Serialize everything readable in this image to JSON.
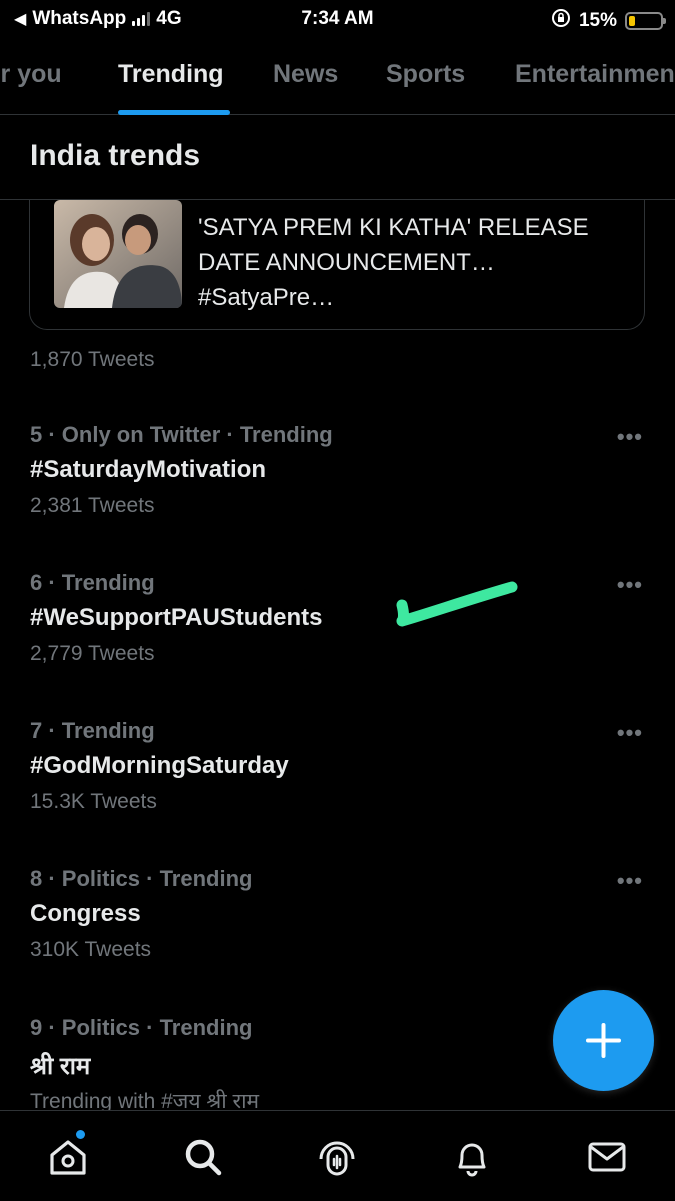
{
  "status_bar": {
    "back_app": "WhatsApp",
    "network": "4G",
    "time": "7:34 AM",
    "battery_percent": "15%",
    "battery_color": "#f5c400"
  },
  "tabs": [
    {
      "label": "For you",
      "active": false
    },
    {
      "label": "Trending",
      "active": true
    },
    {
      "label": "News",
      "active": false
    },
    {
      "label": "Sports",
      "active": false
    },
    {
      "label": "Entertainment",
      "active": false
    }
  ],
  "section": {
    "title": "India trends"
  },
  "news_card": {
    "headline": "'SATYA PREM KI KATHA' RELEASE DATE ANNOUNCEMENT… #SatyaPre…",
    "tweet_count": "1,870 Tweets"
  },
  "trends": [
    {
      "context": "5 · Only on Twitter · Trending",
      "name": "#SaturdayMotivation",
      "count": "2,381 Tweets"
    },
    {
      "context": "6 · Trending",
      "name": "#WeSupportPAUStudents",
      "count": "2,779 Tweets"
    },
    {
      "context": "7 · Trending",
      "name": "#GodMorningSaturday",
      "count": "15.3K Tweets"
    },
    {
      "context": "8 · Politics · Trending",
      "name": "Congress",
      "count": "310K Tweets"
    },
    {
      "context": "9 · Politics · Trending",
      "name": "श्री राम",
      "count": "Trending with #जय श्री राम"
    }
  ],
  "more_glyph": "•••",
  "colors": {
    "accent": "#1d9bf0",
    "annotation_mark": "#3ee8a0",
    "background": "#000000",
    "muted_text": "#71767b"
  },
  "icons": {
    "fab": "plus-icon",
    "nav": [
      "home-icon",
      "search-icon",
      "spaces-icon",
      "bell-icon",
      "mail-icon"
    ]
  }
}
